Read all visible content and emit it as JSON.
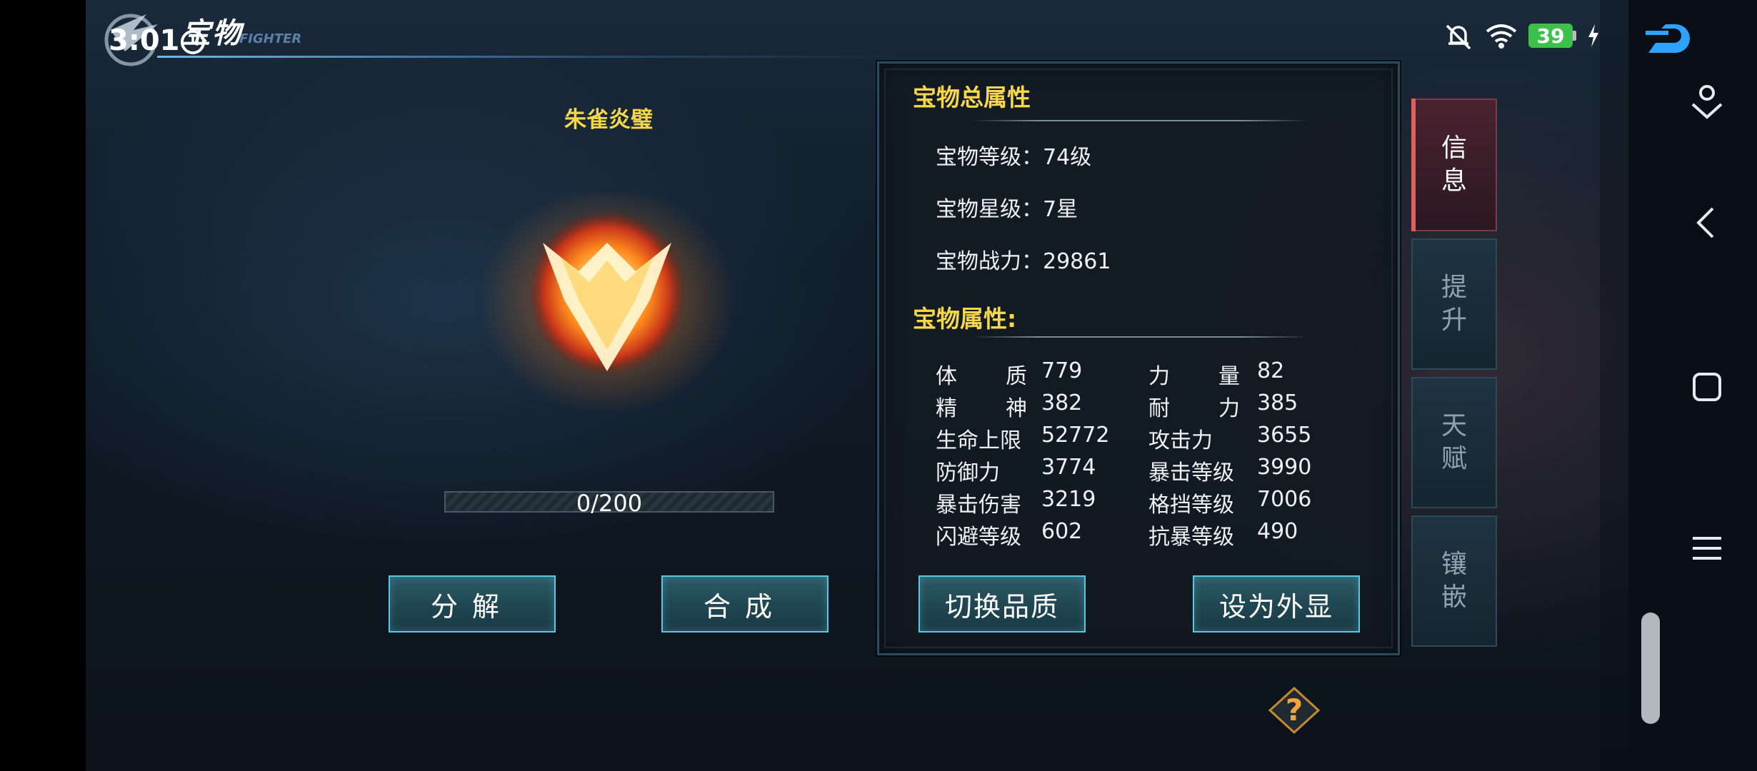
{
  "status_bar": {
    "time": "3:01",
    "battery_level": "39",
    "icons": [
      "alarm-icon",
      "mute-icon",
      "wifi-icon",
      "charging-icon"
    ]
  },
  "header": {
    "title": "宝物",
    "subtitle": "FIGHTER"
  },
  "item": {
    "name": "朱雀炎璧",
    "progress_text": "0/200",
    "progress_value": 0
  },
  "actions": {
    "decompose_label": "分解",
    "synthesize_label": "合成",
    "switch_quality_label": "切换品质",
    "set_appearance_label": "设为外显"
  },
  "panel": {
    "total_title": "宝物总属性",
    "level": "宝物等级：74级",
    "stars": "宝物星级：7星",
    "power": "宝物战力：29861",
    "attr_title": "宝物属性:",
    "attributes": [
      {
        "label": "体质",
        "value": "779"
      },
      {
        "label": "力量",
        "value": "82"
      },
      {
        "label": "精神",
        "value": "382"
      },
      {
        "label": "耐力",
        "value": "385"
      },
      {
        "label": "生命上限",
        "value": "52772"
      },
      {
        "label": "攻击力",
        "value": "3655"
      },
      {
        "label": "防御力",
        "value": "3774"
      },
      {
        "label": "暴击等级",
        "value": "3990"
      },
      {
        "label": "暴击伤害",
        "value": "3219"
      },
      {
        "label": "格挡等级",
        "value": "7006"
      },
      {
        "label": "闪避等级",
        "value": "602"
      },
      {
        "label": "抗暴等级",
        "value": "490"
      }
    ]
  },
  "side_tabs": [
    {
      "label": "信息",
      "active": true
    },
    {
      "label": "提升",
      "active": false
    },
    {
      "label": "天赋",
      "active": false
    },
    {
      "label": "镶嵌",
      "active": false
    }
  ],
  "colors": {
    "gold": "#f6d74a",
    "button_border": "#5dc6e0",
    "active_tab": "#e0605c"
  }
}
